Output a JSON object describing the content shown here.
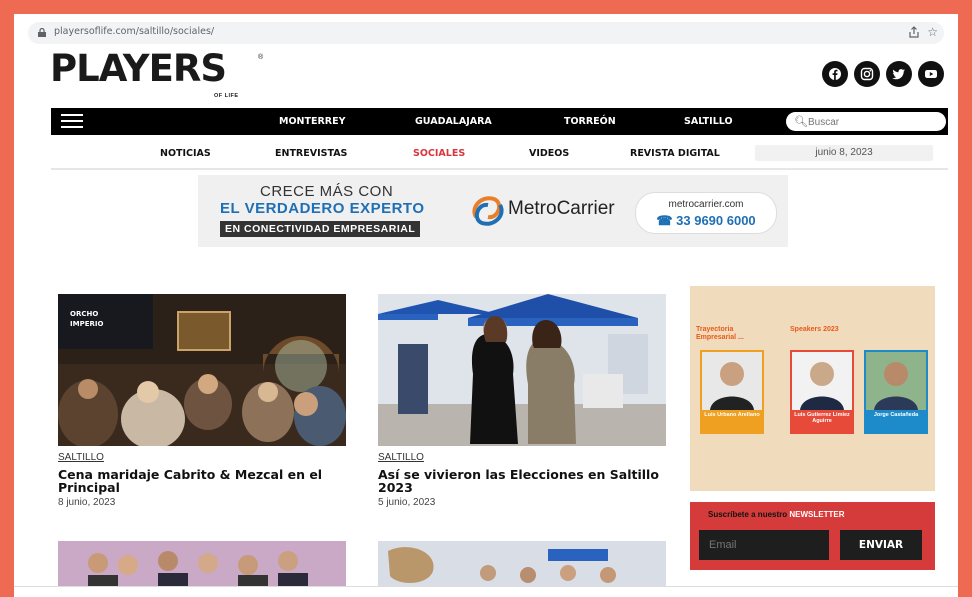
{
  "browser": {
    "url": "playersoflife.com/saltillo/sociales/"
  },
  "logo": {
    "text": "PLAYERS",
    "sub": "OF LIFE",
    "reg": "®"
  },
  "social_icons": [
    "facebook-icon",
    "instagram-icon",
    "twitter-icon",
    "youtube-icon"
  ],
  "main_nav": {
    "items": [
      "MONTERREY",
      "GUADALAJARA",
      "TORREÓN",
      "SALTILLO"
    ],
    "search_placeholder": "Buscar"
  },
  "sub_nav": {
    "items": [
      "NOTICIAS",
      "ENTREVISTAS",
      "SOCIALES",
      "VIDEOS",
      "REVISTA DIGITAL"
    ],
    "active": "SOCIALES",
    "date": "junio 8, 2023"
  },
  "banner": {
    "line1": "CRECE MÁS CON",
    "line2": "EL VERDADERO EXPERTO",
    "line3": "EN CONECTIVIDAD EMPRESARIAL",
    "brand": "MetroCarrier",
    "url": "metrocarrier.com",
    "phone": "33 9690 6000"
  },
  "articles": [
    {
      "category": "SALTILLO",
      "title": "Cena maridaje Cabrito & Mezcal en el Principal",
      "date": "8 junio, 2023"
    },
    {
      "category": "SALTILLO",
      "title": "Así se vivieron las Elecciones en Saltillo 2023",
      "date": "5 junio, 2023"
    }
  ],
  "sidebar_ad": {
    "label1": "Trayectoria Empresarial ...",
    "label2": "Speakers 2023",
    "speakers": [
      "Luis Urbano Arellano",
      "Luis Gutierrez Limiez Aguirre",
      "Jorge Castañeda"
    ]
  },
  "newsletter": {
    "title_prefix": "Suscríbete a nuestro",
    "title_highlight": "NEWSLETTER",
    "email_placeholder": "Email",
    "button": "ENVIAR"
  },
  "colors": {
    "accent": "#d9363e",
    "background": "#ee6a53",
    "nav": "#000000",
    "banner_blue": "#1f6fb5"
  }
}
